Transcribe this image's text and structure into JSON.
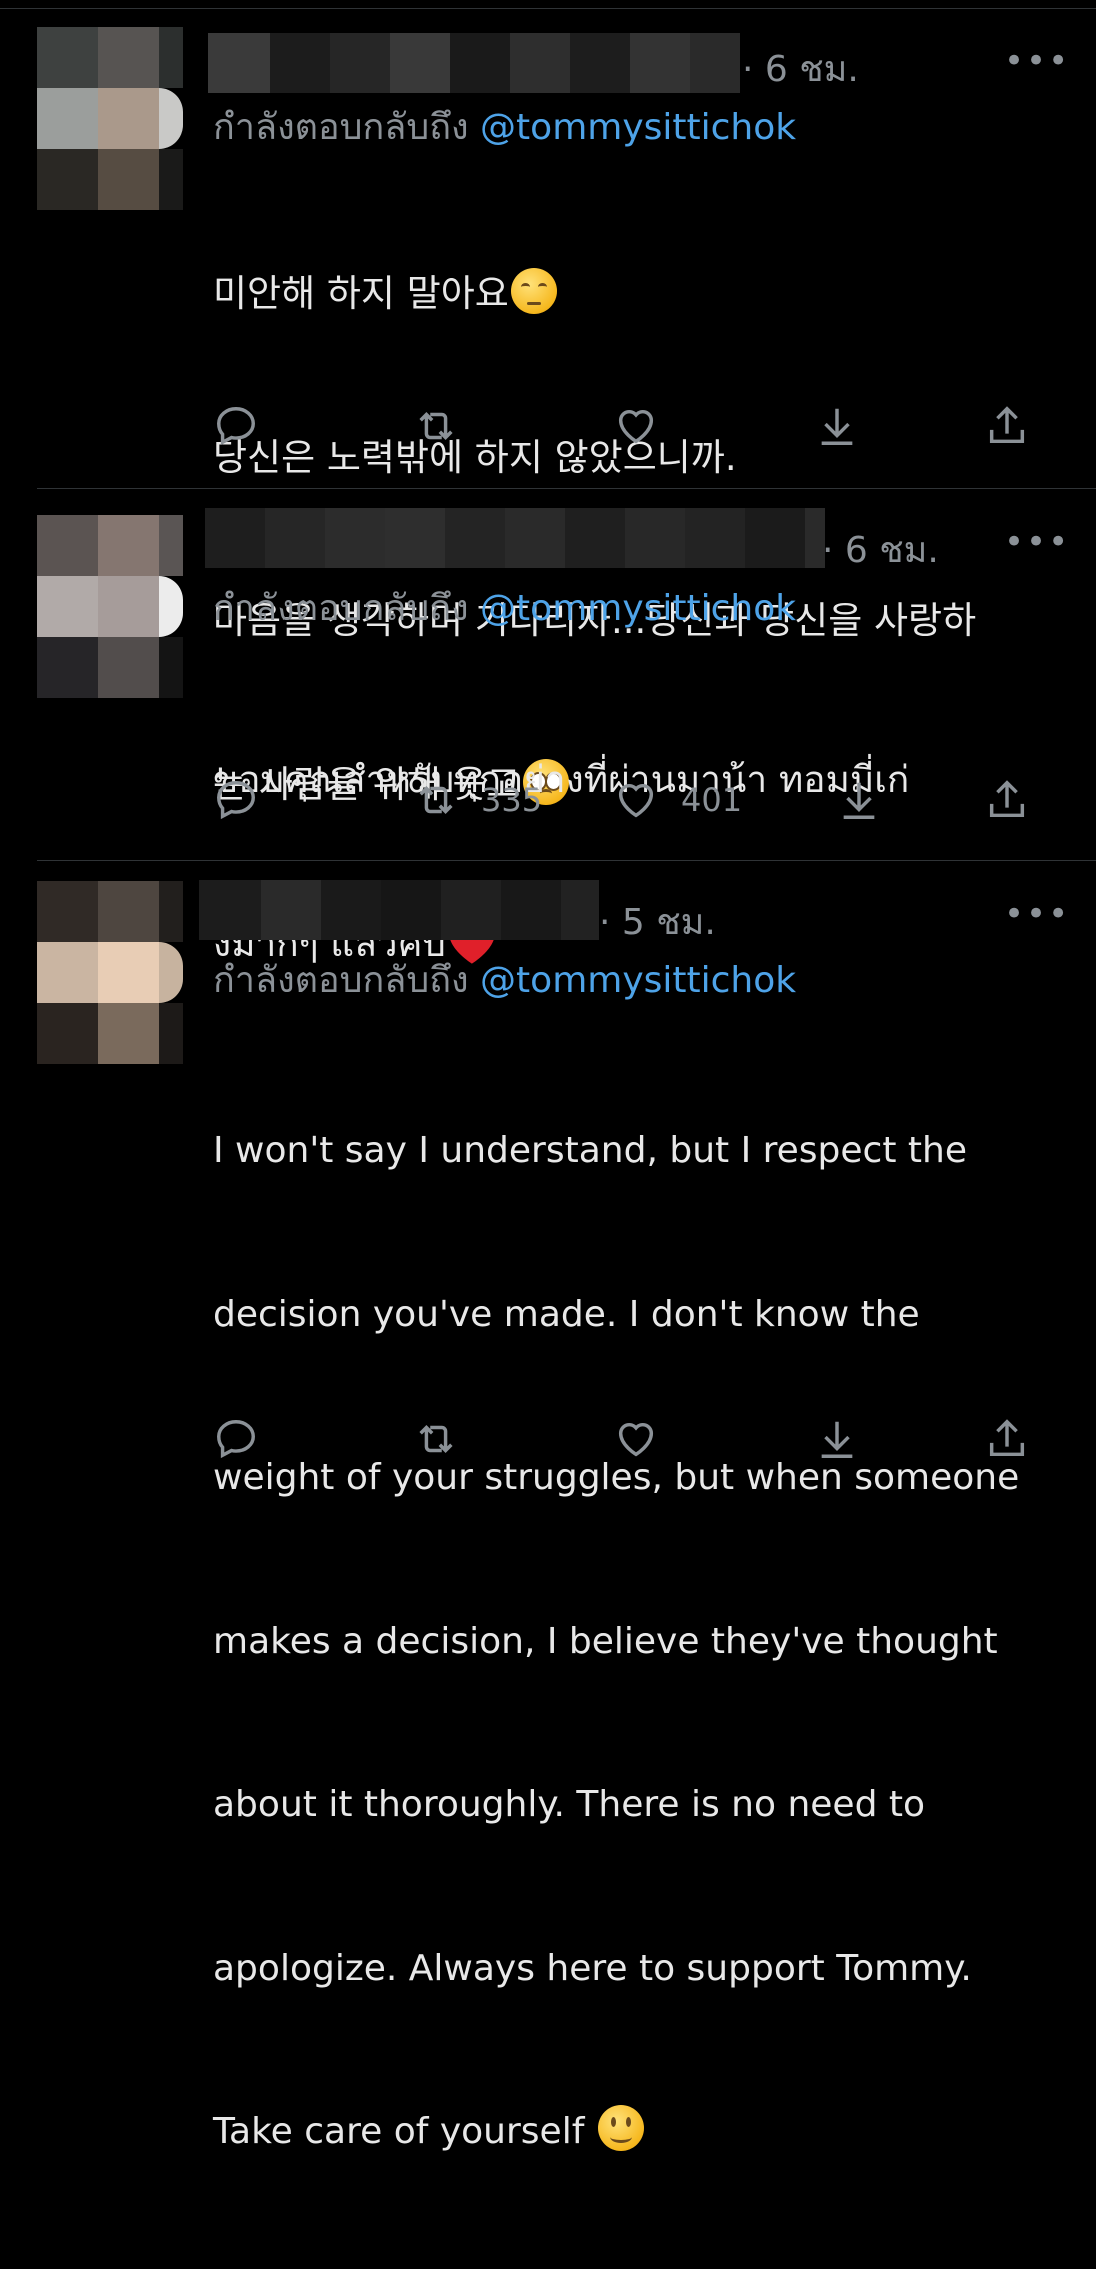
{
  "tweets": [
    {
      "time": "· 6 ชม.",
      "reply_prefix": "กำลังตอบกลับถึง",
      "reply_handle": "@tommysittichok",
      "lines": [
        "미안해 하지 말아요",
        "당신은 노력밖에 하지 않았으니까.",
        "마음을 생각하며 기다리자...당신과 당신을 사랑하",
        "는 사람을 위해 웃고"
      ],
      "emojis": [
        "pensive-face",
        "pleading-face"
      ],
      "retweets": "",
      "likes": ""
    },
    {
      "time": "· 6 ชม.",
      "reply_prefix": "กำลังตอบกลับถึง",
      "reply_handle": "@tommysittichok",
      "lines": [
        "ขอบคุณสำหรับทุกอย่างที่ผ่านมาน้า ทอมมี่เก่",
        "งมากๆ แล้วคับ"
      ],
      "emojis": [
        "red-heart"
      ],
      "retweets": "335",
      "likes": "401"
    },
    {
      "time": "· 5 ชม.",
      "reply_prefix": "กำลังตอบกลับถึง",
      "reply_handle": "@tommysittichok",
      "lines": [
        "I won't say I understand, but I respect the",
        "decision you've made. I don't know the",
        "weight of your struggles, but when someone",
        "makes a decision, I believe they've thought",
        "about it thoroughly. There is no need to",
        "apologize. Always here to support Tommy.",
        "Take care of yourself"
      ],
      "emojis": [
        "slightly-smiling-face"
      ],
      "retweets": "",
      "likes": ""
    }
  ],
  "colors": {
    "background": "#000000",
    "text": "#e7e9ea",
    "muted": "#8b9197",
    "link": "#4ea3e8",
    "divider": "#2f3336"
  },
  "icons": [
    "reply-icon",
    "retweet-icon",
    "like-icon",
    "download-icon",
    "share-icon",
    "more-icon"
  ]
}
